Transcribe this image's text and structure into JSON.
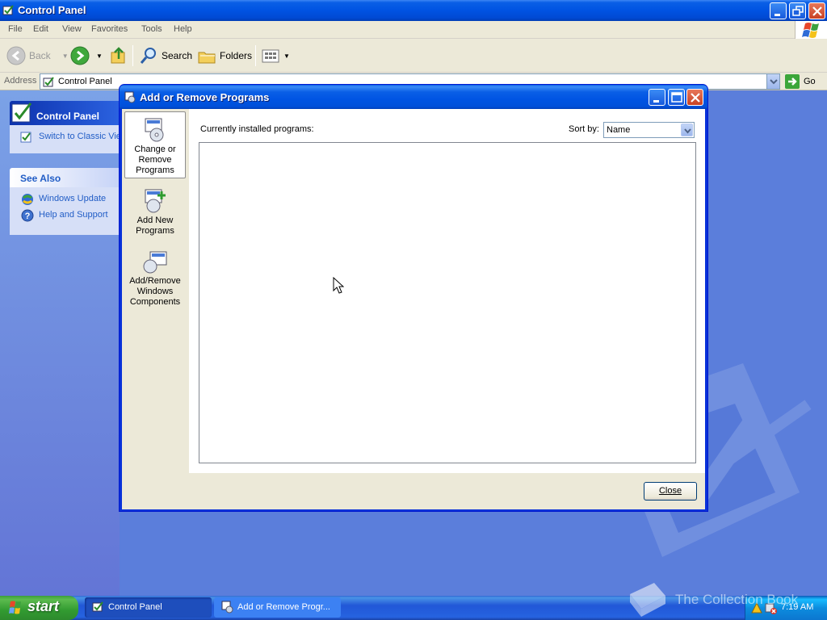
{
  "control_panel": {
    "title": "Control Panel",
    "menu": [
      "File",
      "Edit",
      "View",
      "Favorites",
      "Tools",
      "Help"
    ],
    "toolbar": {
      "back_label": "Back",
      "search_label": "Search",
      "folders_label": "Folders"
    },
    "address": {
      "label": "Address",
      "value": "Control Panel",
      "go_label": "Go"
    },
    "taskpane": {
      "panel_title": "Control Panel",
      "switch_link": "Switch to Classic View",
      "see_also_title": "See Also",
      "links": [
        "Windows Update",
        "Help and Support"
      ]
    }
  },
  "dialog": {
    "title": "Add or Remove Programs",
    "nav": [
      {
        "label_lines": [
          "Change or",
          "Remove",
          "Programs"
        ],
        "selected": true
      },
      {
        "label_lines": [
          "Add New",
          "Programs"
        ],
        "selected": false
      },
      {
        "label_lines": [
          "Add/Remove",
          "Windows",
          "Components"
        ],
        "selected": false
      }
    ],
    "installed_label": "Currently installed programs:",
    "sort_label": "Sort by:",
    "sort_value": "Name",
    "programs": [],
    "close_label": "Close"
  },
  "taskbar": {
    "start_label": "start",
    "tasks": [
      {
        "label": "Control Panel",
        "active": true
      },
      {
        "label": "Add or Remove Progr...",
        "active": false
      }
    ],
    "clock": "7:19 AM"
  },
  "watermark_text": "The Collection Book",
  "colors": {
    "xp_blue": "#0054e3",
    "desktop": "#5a7edc",
    "dialog_face": "#ece9d8",
    "start_green": "#329b31"
  }
}
